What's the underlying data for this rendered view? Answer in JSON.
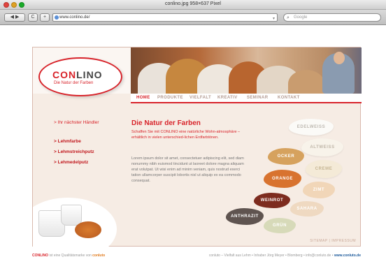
{
  "window": {
    "title": "conlino.jpg 958×637 Pixel"
  },
  "toolbar": {
    "back_label": "◀ ▶",
    "reload_label": "C",
    "add_label": "+",
    "url": "www.conlino.de/",
    "search_placeholder": "Google"
  },
  "site": {
    "logo": {
      "name_a": "CON",
      "name_b": "LINO",
      "tagline": "Die Natur der Farben"
    },
    "nav": [
      "HOME",
      "PRODUKTE",
      "VIELFALT",
      "KREATIV",
      "SEMINAR",
      "KONTAKT"
    ],
    "sidebar": {
      "dealer": "> Ihr nächster Händler",
      "links": [
        "> Lehmfarbe",
        "> Lehmstreichputz",
        "> Lehmedelputz"
      ]
    },
    "headline": "Die Natur der Farben",
    "intro": "Schaffen Sie mit CONLINO eine natürliche Wohn-atmosphäre – erhältlich in vielen unterschied-lichen Erdfarbtönen.",
    "lorem": "Lorem ipsum dolor sit amet, consectetuer adipiscing elit, sed diam nonummy nibh euismod tincidunt ut laoreet dolore magna aliquam erat volutpat. Ut wisi enim ad minim veniam, quis nostrud exerci tation ullamcorper suscipit lobortis nisl ut aliquip ex ea commodo consequat.",
    "colors": [
      "EDELWEISS",
      "ALTWEISS",
      "CREME",
      "OCKER",
      "ORANGE",
      "ZIMT",
      "WEINROT",
      "SAHARA",
      "ANTHRAZIT",
      "GRÜN"
    ],
    "footer_links": "SITEMAP | IMPRESSUM"
  },
  "bottom": {
    "left_brand": "CONLINO",
    "left_text": " ist eine Qualitätsmarke von ",
    "left_brand2": "conluto",
    "right_text": "conluto – Vielfalt aus Lehm • Inhaber Jörg Meyer • Blomberg • info@conluto.de • ",
    "right_url": "www.conluto.de"
  },
  "accent_color": "#d8232a"
}
